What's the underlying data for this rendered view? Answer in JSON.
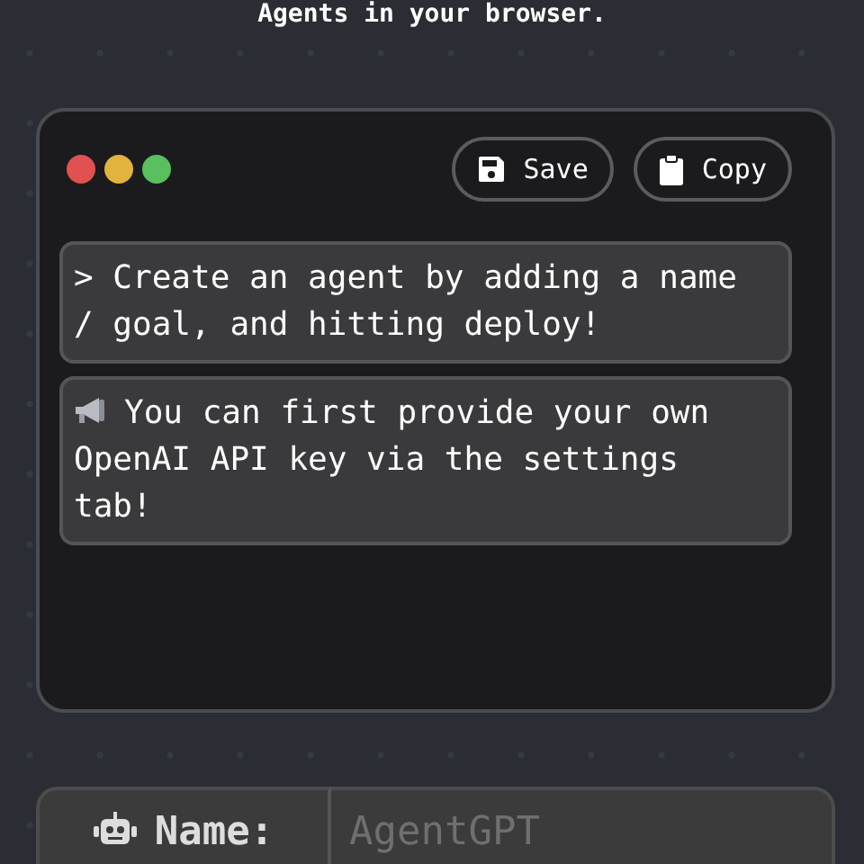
{
  "heading": "Agents in your browser.",
  "window": {
    "buttons": [
      {
        "kind": "save",
        "label": "Save"
      },
      {
        "kind": "copy",
        "label": "Copy"
      }
    ],
    "messages": [
      {
        "kind": "prompt",
        "text": "> Create an agent by adding a name / goal, and hitting deploy!"
      },
      {
        "kind": "notice",
        "text": "You can first provide your own OpenAI API key via the settings tab!"
      }
    ]
  },
  "name_field": {
    "label": "Name:",
    "placeholder": "AgentGPT"
  }
}
